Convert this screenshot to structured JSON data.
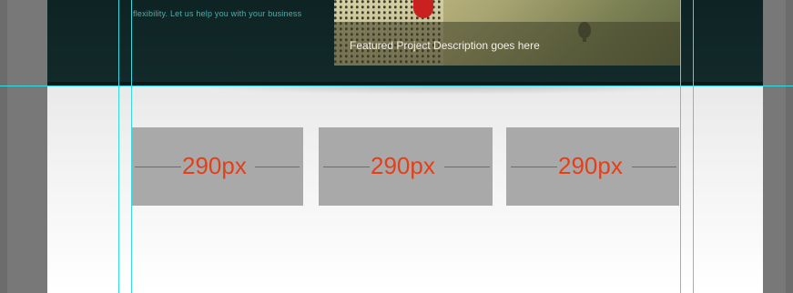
{
  "header": {
    "tagline": "flexibility. Let us help you with your business"
  },
  "featured": {
    "caption": "Featured Project Description goes here"
  },
  "columns": [
    {
      "label": "290px"
    },
    {
      "label": "290px"
    },
    {
      "label": "290px"
    }
  ],
  "colors": {
    "header_bg": "#0e2424",
    "tagline": "#3fb3b3",
    "column_box": "#a9a9a9",
    "dimension": "#e3401a",
    "guide": "#38d9e0",
    "pasteboard": "#787878"
  }
}
